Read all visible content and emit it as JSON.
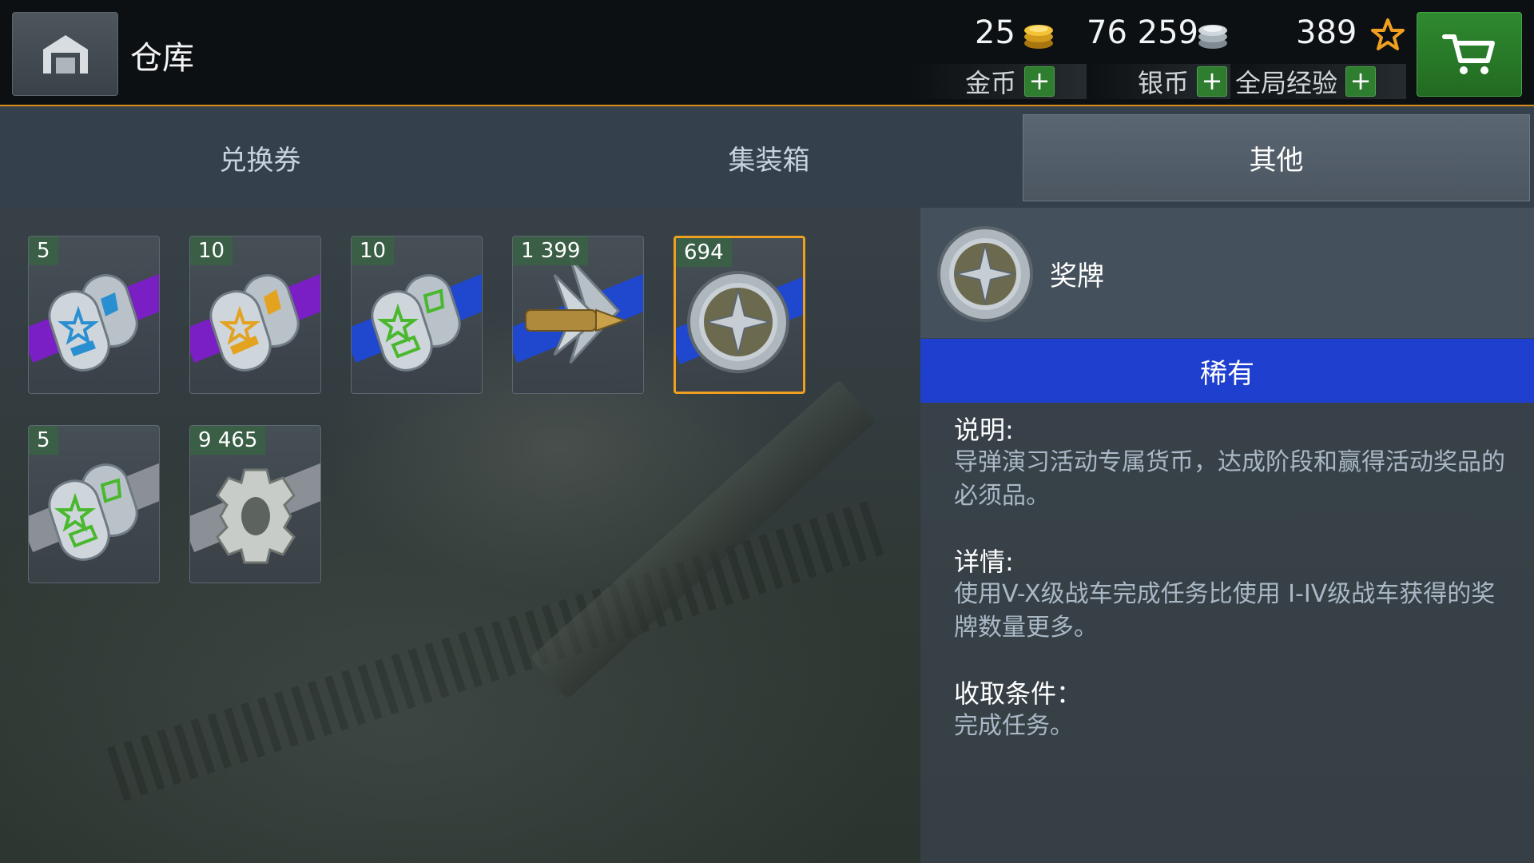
{
  "header": {
    "title": "仓库",
    "currencies": [
      {
        "amount": "25",
        "label": "金币",
        "icon": "gold-coin-icon"
      },
      {
        "amount": "76 259",
        "label": "银币",
        "icon": "silver-coin-icon"
      },
      {
        "amount": "389",
        "label": "全局经验",
        "icon": "star-icon"
      }
    ],
    "plus": "+"
  },
  "tabs": [
    {
      "label": "兑换券",
      "active": false
    },
    {
      "label": "集装箱",
      "active": false
    },
    {
      "label": "其他",
      "active": true
    }
  ],
  "items": [
    {
      "count": "5",
      "icon": "blue-star-dogtag-icon",
      "band_color": "#7a1fc4"
    },
    {
      "count": "10",
      "icon": "gold-star-dogtag-icon",
      "band_color": "#7a1fc4"
    },
    {
      "count": "10",
      "icon": "green-star-dogtag-icon",
      "band_color": "#1f48cf"
    },
    {
      "count": "1 399",
      "icon": "missile-icon",
      "band_color": "#1f48cf"
    },
    {
      "count": "694",
      "icon": "medal-icon",
      "band_color": "#1f48cf",
      "selected": true
    },
    {
      "count": "5",
      "icon": "green-star-dogtag-icon",
      "band_color": "#8a9096"
    },
    {
      "count": "9 465",
      "icon": "gear-part-icon",
      "band_color": "#8a9096"
    }
  ],
  "detail": {
    "name": "奖牌",
    "rarity": "稀有",
    "rarity_color": "#1f3fcf",
    "description_title": "说明:",
    "description": "导弹演习活动专属货币，达成阶段和赢得活动奖品的必须品。",
    "details_title": "详情:",
    "details": "使用V-X级战车完成任务比使用 I-IV级战车获得的奖牌数量更多。",
    "conditions_title": "收取条件：",
    "conditions": "完成任务。"
  }
}
